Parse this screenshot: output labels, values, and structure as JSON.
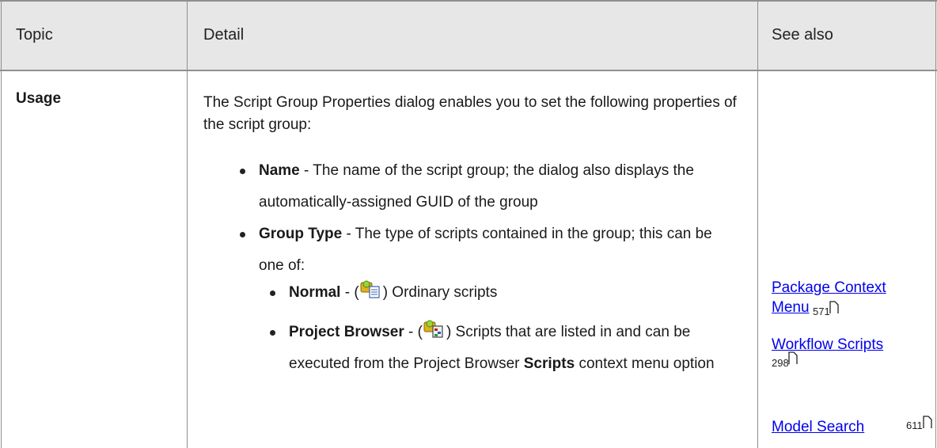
{
  "table": {
    "headers": {
      "topic": "Topic",
      "detail": "Detail",
      "see_also": "See also"
    },
    "row": {
      "topic": "Usage",
      "intro": "The Script Group Properties dialog enables you to set the following properties of the script group:",
      "bullets": [
        {
          "term": "Name",
          "text": " - The name of the script group; the dialog also displays the automatically-assigned GUID of the group"
        },
        {
          "term": "Group Type",
          "text": " - The type of scripts contained in the group; this can be one of:"
        }
      ],
      "sub_bullets": [
        {
          "term": "Normal",
          "pre": " - (",
          "post": ") Ordinary scripts",
          "icon": "normal-script-group-icon"
        },
        {
          "term": "Project Browser",
          "pre": " - (",
          "post": ") Scripts that are listed in and can be executed from the Project Browser ",
          "term2": "Scripts",
          "post2": " context menu option",
          "icon": "project-browser-script-group-icon"
        }
      ]
    },
    "see_also": [
      {
        "line1": "Package Context",
        "line2": "Menu",
        "page": "571"
      },
      {
        "line1": "Workflow Scripts",
        "page": "298"
      },
      {
        "line1": "Model Search",
        "page": "611"
      }
    ]
  },
  "colors": {
    "header_bg": "#e7e7e7",
    "grid": "#8f8f8f",
    "link": "#0000ee"
  }
}
